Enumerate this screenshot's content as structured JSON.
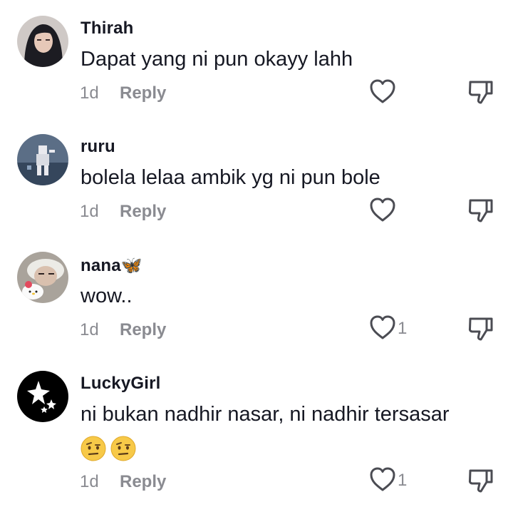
{
  "comments": [
    {
      "username": "Thirah",
      "text": "Dapat yang ni pun okayy lahh",
      "time": "1d",
      "reply": "Reply",
      "likes": ""
    },
    {
      "username": "ruru",
      "text": "bolela lelaa ambik yg ni pun bole",
      "time": "1d",
      "reply": "Reply",
      "likes": ""
    },
    {
      "username": "nana🦋",
      "text": "wow..",
      "time": "1d",
      "reply": "Reply",
      "likes": "1"
    },
    {
      "username": "LuckyGirl",
      "text": "ni bukan nadhir nasar, ni nadhir tersasar",
      "emojis": [
        "🤨",
        "🤨"
      ],
      "time": "1d",
      "reply": "Reply",
      "likes": "1"
    }
  ],
  "icons": {
    "like": "heart-outline-icon",
    "dislike": "thumbs-down-icon"
  },
  "colors": {
    "text": "#161823",
    "muted": "#8a8b91"
  }
}
